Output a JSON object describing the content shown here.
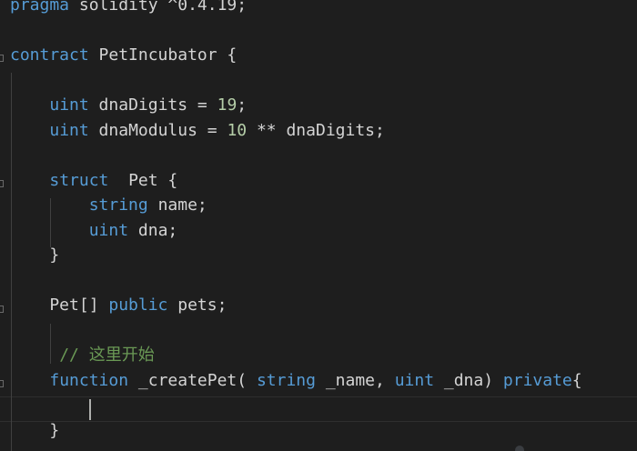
{
  "editor": {
    "language": "solidity",
    "lines": [
      [
        {
          "t": "pragma",
          "c": "kw"
        },
        {
          "t": " solidity ^0.4.19;",
          "c": "ident"
        }
      ],
      [],
      [
        {
          "t": "contract",
          "c": "kw"
        },
        {
          "t": " PetIncubator {",
          "c": "ident"
        }
      ],
      [],
      [
        {
          "t": "    "
        },
        {
          "t": "uint",
          "c": "kw"
        },
        {
          "t": " dnaDigits = ",
          "c": "ident"
        },
        {
          "t": "19",
          "c": "num"
        },
        {
          "t": ";",
          "c": "ident"
        }
      ],
      [
        {
          "t": "    "
        },
        {
          "t": "uint",
          "c": "kw"
        },
        {
          "t": " dnaModulus = ",
          "c": "ident"
        },
        {
          "t": "10",
          "c": "num"
        },
        {
          "t": " ** dnaDigits;",
          "c": "ident"
        }
      ],
      [],
      [
        {
          "t": "    "
        },
        {
          "t": "struct",
          "c": "kw"
        },
        {
          "t": "  Pet {",
          "c": "ident"
        }
      ],
      [
        {
          "t": "        "
        },
        {
          "t": "string",
          "c": "kw"
        },
        {
          "t": " name;",
          "c": "ident"
        }
      ],
      [
        {
          "t": "        "
        },
        {
          "t": "uint",
          "c": "kw"
        },
        {
          "t": " dna;",
          "c": "ident"
        }
      ],
      [
        {
          "t": "    }",
          "c": "ident"
        }
      ],
      [],
      [
        {
          "t": "    Pet[] ",
          "c": "ident"
        },
        {
          "t": "public",
          "c": "kw"
        },
        {
          "t": " pets;",
          "c": "ident"
        }
      ],
      [],
      [
        {
          "t": "     "
        },
        {
          "t": "// 这里开始",
          "c": "cmt"
        }
      ],
      [
        {
          "t": "    "
        },
        {
          "t": "function",
          "c": "kw"
        },
        {
          "t": " _createPet( ",
          "c": "ident"
        },
        {
          "t": "string",
          "c": "kw"
        },
        {
          "t": " _name, ",
          "c": "ident"
        },
        {
          "t": "uint",
          "c": "kw"
        },
        {
          "t": " _dna) ",
          "c": "ident"
        },
        {
          "t": "private",
          "c": "kw"
        },
        {
          "t": "{",
          "c": "ident"
        }
      ],
      [],
      [
        {
          "t": "    }",
          "c": "ident"
        }
      ]
    ]
  },
  "colors": {
    "background": "#1e1e1e",
    "keyword": "#569cd6",
    "number": "#b5cea8",
    "comment": "#6a9955",
    "text": "#d4d4d4"
  }
}
